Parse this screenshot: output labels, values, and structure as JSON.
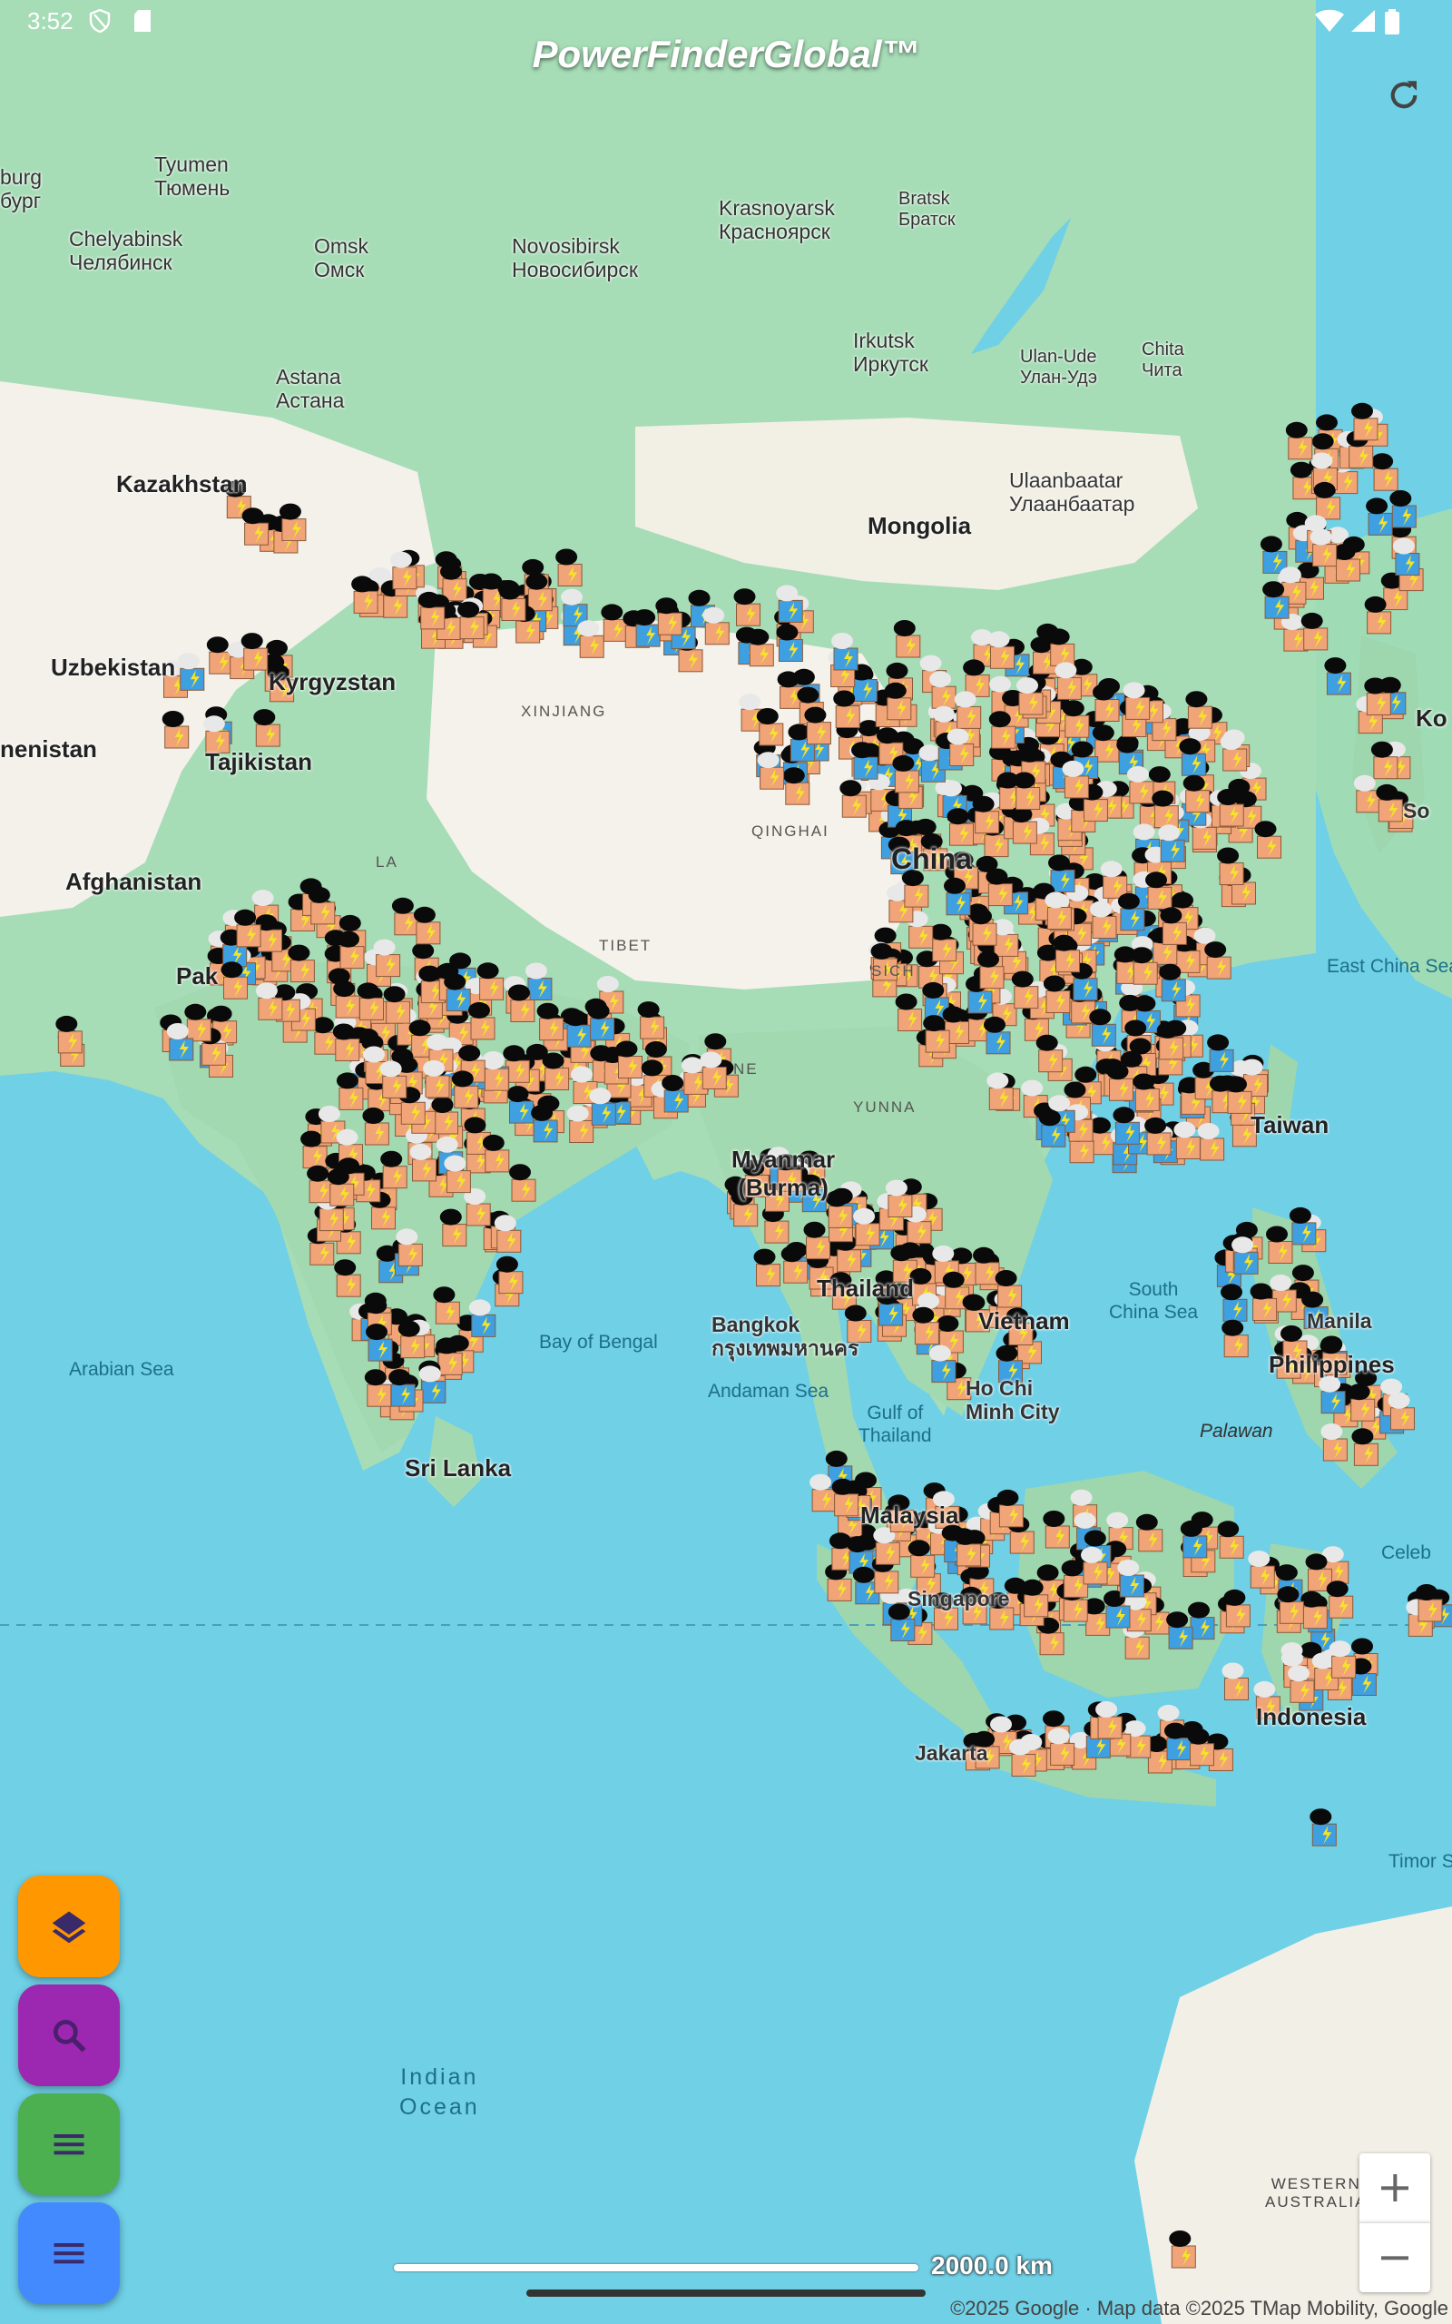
{
  "status_bar": {
    "time": "3:52"
  },
  "app": {
    "title": "PowerFinderGlobal™"
  },
  "map": {
    "colors": {
      "water": "#6fd0e6",
      "land_green": "#9fdcb6",
      "land_desert": "#f3f1ea",
      "forest": "#7cc79a"
    },
    "labels": {
      "tyumen": "Tyumen\nТюмень",
      "ekaterinburg": "burg\nбург",
      "chelyabinsk": "Chelyabinsk\nЧелябинск",
      "omsk": "Omsk\nОмск",
      "novosibirsk": "Novosibirsk\nНовосибирск",
      "krasnoyarsk": "Krasnoyarsk\nКрасноярск",
      "bratsk": "Bratsk\nБратск",
      "irkutsk": "Irkutsk\nИркутск",
      "ulan_ude": "Ulan-Ude\nУлан-Удэ",
      "chita": "Chita\nЧита",
      "astana": "Astana\nАстана",
      "ulaanbaatar": "Ulaanbaatar\nУлаанбаатар",
      "kazakhstan": "Kazakhstan",
      "mongolia": "Mongolia",
      "uzbekistan": "Uzbekistan",
      "kyrgyzstan": "Kyrgyzstan",
      "turkmenistan": "nenistan",
      "tajikistan": "Tajikistan",
      "afghanistan": "Afghanistan",
      "pakistan": "Pak",
      "xinjiang": "XINJIANG",
      "qinghai": "QINGHAI",
      "tibet": "TIBET",
      "china": "China",
      "east_china_sea": "East China Sea",
      "myanmar": "Myanmar\n(Burma)",
      "taiwan": "Taiwan",
      "south_china_sea": "South\nChina Sea",
      "bay_of_bengal": "Bay of Bengal",
      "arabian_sea": "Arabian Sea",
      "andaman_sea": "Andaman Sea",
      "gulf_of_thailand": "Gulf of\nThailand",
      "bangkok": "Bangkok\nกรุงเทพมหานคร",
      "thailand": "Thailand",
      "vietnam": "Vietnam",
      "ho_chi_minh": "Ho Chi\nMinh City",
      "manila": "Manila",
      "philippines": "Philippines",
      "palawan": "Palawan",
      "celebes": "Celeb",
      "malaysia": "Malaysia",
      "singapore": "Singapore",
      "indonesia": "Indonesia",
      "jakarta": "Jakarta",
      "sri_lanka": "Sri Lanka",
      "timor_sea": "Timor S",
      "indian_ocean": "Indian\nOcean",
      "western_australia": "WESTERN\nAUSTRALIA",
      "korea": "Ko",
      "seoul": "So",
      "nepal": "NE",
      "la": "LA",
      "sichuan": "SICH",
      "yunnan": "YUNNA"
    }
  },
  "scale": {
    "label": "2000.0 km"
  },
  "attribution": "©2025 Google · Map data ©2025 TMap Mobility, Google",
  "icons": {
    "refresh": "refresh-icon",
    "layers": "layers-icon",
    "search": "search-icon",
    "menu_green": "menu-icon",
    "menu_blue": "menu-icon",
    "zoom_in": "plus-icon",
    "zoom_out": "minus-icon"
  },
  "fab_colors": {
    "layers": "#ff9800",
    "search": "#9c27b0",
    "menu_green": "#4caf50",
    "menu_blue": "#448aff"
  }
}
